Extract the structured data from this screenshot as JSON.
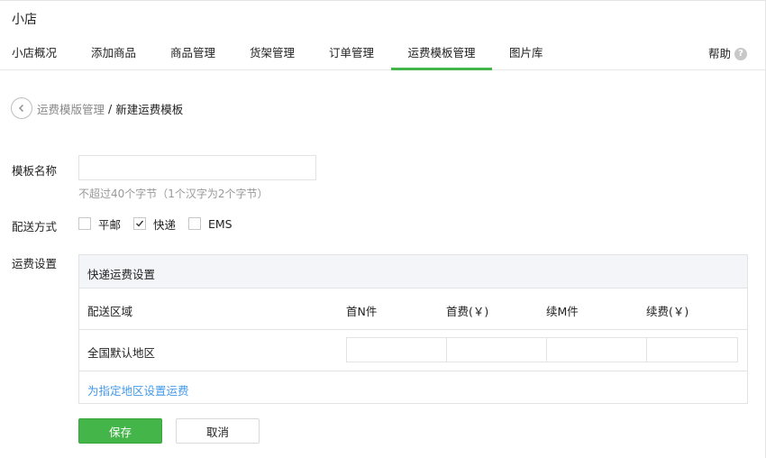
{
  "app": {
    "title": "小店"
  },
  "nav": {
    "tabs": [
      {
        "label": "小店概况"
      },
      {
        "label": "添加商品"
      },
      {
        "label": "商品管理"
      },
      {
        "label": "货架管理"
      },
      {
        "label": "订单管理"
      },
      {
        "label": "运费模板管理",
        "active": true
      },
      {
        "label": "图片库"
      }
    ],
    "help_label": "帮助",
    "help_icon": "question-circle-icon"
  },
  "breadcrumb": {
    "back_icon": "chevron-left-circle-icon",
    "parent": "运费模版管理",
    "separator": "/",
    "current": "新建运费模板"
  },
  "form": {
    "name_label": "模板名称",
    "name_value": "",
    "name_hint": "不超过40个字节（1个汉字为2个字节）",
    "delivery_label": "配送方式",
    "delivery_options": [
      {
        "label": "平邮",
        "checked": false
      },
      {
        "label": "快递",
        "checked": true
      },
      {
        "label": "EMS",
        "checked": false
      }
    ],
    "fee_label": "运费设置"
  },
  "fee_table": {
    "title": "快递运费设置",
    "columns": [
      "配送区域",
      "首N件",
      "首费(￥)",
      "续M件",
      "续费(￥)"
    ],
    "rows": [
      {
        "region": "全国默认地区",
        "values": [
          "",
          "",
          "",
          ""
        ]
      }
    ],
    "add_region_link": "为指定地区设置运费"
  },
  "actions": {
    "save": "保存",
    "cancel": "取消"
  },
  "colors": {
    "accent": "#44b549",
    "link": "#459ae9",
    "table_header_bg": "#f4f5f9"
  }
}
